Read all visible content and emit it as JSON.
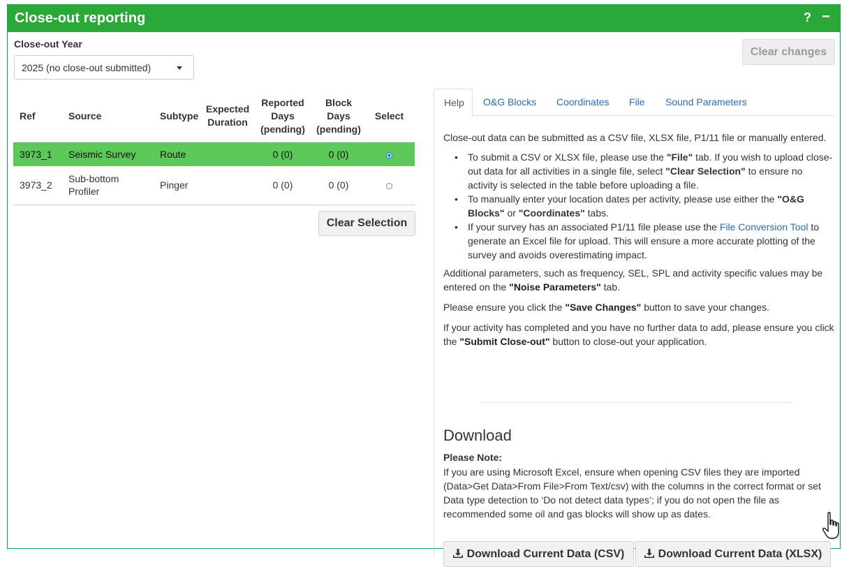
{
  "panel": {
    "title": "Close-out reporting",
    "help_label": "?",
    "minimize_label": "−"
  },
  "year": {
    "label": "Close-out Year",
    "selected": "2025 (no close-out submitted)"
  },
  "clear_changes_label": "Clear changes",
  "activity_table": {
    "headers": {
      "ref": "Ref",
      "source": "Source",
      "subtype": "Subtype",
      "expected_duration": "Expected Duration",
      "reported_days": "Reported Days (pending)",
      "block_days": "Block Days (pending)",
      "select": "Select"
    },
    "rows": [
      {
        "ref": "3973_1",
        "source": "Seismic Survey",
        "subtype": "Route",
        "expected_duration": "",
        "reported_days": "0 (0)",
        "block_days": "0 (0)",
        "selected": true
      },
      {
        "ref": "3973_2",
        "source": "Sub-bottom Profiler",
        "subtype": "Pinger",
        "expected_duration": "",
        "reported_days": "0 (0)",
        "block_days": "0 (0)",
        "selected": false
      }
    ]
  },
  "clear_selection_label": "Clear Selection",
  "tabs": [
    "Help",
    "O&G Blocks",
    "Coordinates",
    "File",
    "Sound Parameters"
  ],
  "help": {
    "intro": "Close-out data can be submitted as a CSV file, XLSX file, P1/11 file or manually entered.",
    "b1_a": "To submit a CSV or XLSX file, please use the ",
    "b1_b": "\"File\"",
    "b1_c": " tab. If you wish to upload close-out data for all activities in a single file, select ",
    "b1_d": "\"Clear Selection\"",
    "b1_e": " to ensure no activity is selected in the table before uploading a file.",
    "b2_a": "To manually enter your location dates per activity, please use either the ",
    "b2_b": "\"O&G Blocks\"",
    "b2_c": " or ",
    "b2_d": "\"Coordinates\"",
    "b2_e": " tabs.",
    "b3_a": "If your survey has an associated P1/11 file please use the ",
    "b3_link": "File Conversion Tool",
    "b3_c": " to generate an Excel file for upload. This will ensure a more accurate plotting of the survey and avoids overestimating impact.",
    "p2_a": "Additional parameters, such as frequency, SEL, SPL and activity specific values may be entered on the ",
    "p2_b": "\"Noise Parameters\"",
    "p2_c": " tab.",
    "p3_a": "Please ensure you click the ",
    "p3_b": "\"Save Changes\"",
    "p3_c": " button to save your changes.",
    "p4_a": "If your activity has completed and you have no further data to add, please ensure you click the ",
    "p4_b": "\"Submit Close-out\"",
    "p4_c": " button to close-out your application."
  },
  "download": {
    "title": "Download",
    "note_title": "Please Note:",
    "note_body": "If you are using Microsoft Excel, ensure when opening CSV files they are imported (Data>Get Data>From File>From Text/csv) with the columns in the correct format or set Data type detection to ‘Do not detect data types’; if you do not open the file as recommended some oil and gas blocks will show up as dates.",
    "csv_label": "Download Current Data (CSV)",
    "xlsx_label": "Download Current Data (XLSX)"
  },
  "colors": {
    "header_green": "#2aa838",
    "selected_row": "#5dc85a",
    "link_blue": "#2b6cb0"
  },
  "icons": [
    "download-icon",
    "hand-pointer-cursor-icon"
  ]
}
